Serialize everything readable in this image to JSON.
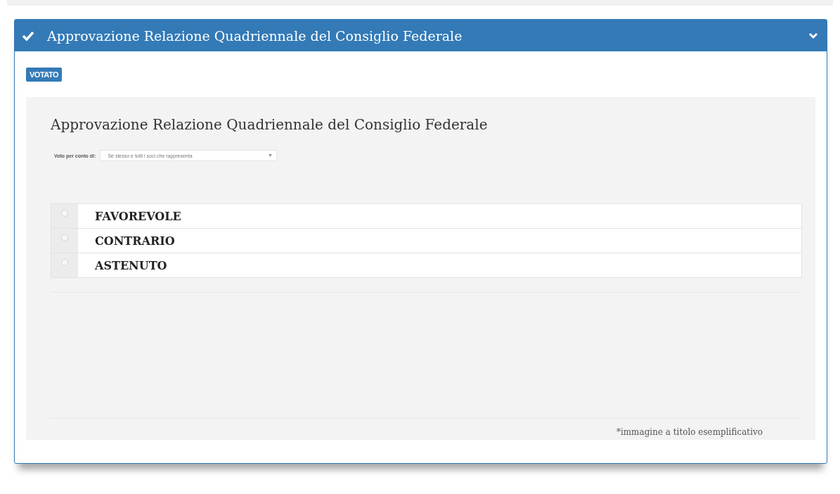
{
  "panel": {
    "title": "Approvazione Relazione Quadriennale del Consiglio Federale",
    "expanded": true
  },
  "badge": "VOTATO",
  "ballot": {
    "title": "Approvazione Relazione Quadriennale del Consiglio Federale",
    "proxy": {
      "label": "Voto per conto di:",
      "value": "Sé stesso e tutti i soci che rappresenta"
    },
    "options": [
      {
        "label": "FAVOREVOLE",
        "selected": false
      },
      {
        "label": "CONTRARIO",
        "selected": false
      },
      {
        "label": "ASTENUTO",
        "selected": false
      }
    ],
    "footnote": "*immagine a titolo esemplificativo"
  }
}
